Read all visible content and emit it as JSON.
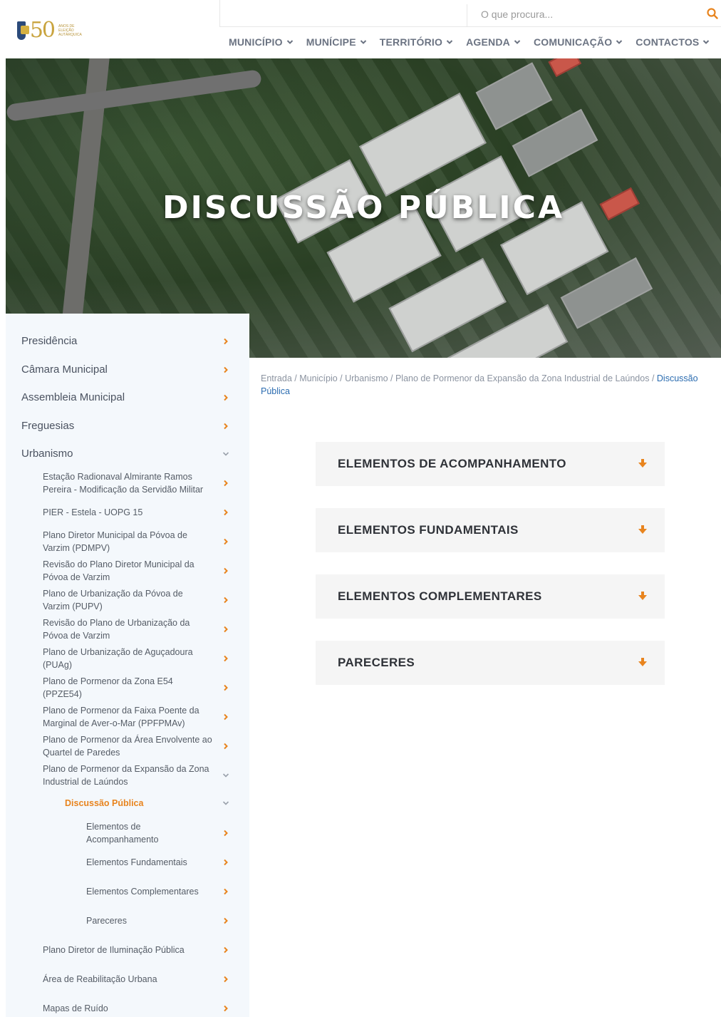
{
  "header": {
    "logo": {
      "number": "50",
      "tagline": "ANOS DE ELEIÇÃO AUTÁRQUICA"
    },
    "search": {
      "placeholder": "O que procura..."
    },
    "nav": [
      {
        "label": "MUNICÍPIO"
      },
      {
        "label": "MUNÍCIPE"
      },
      {
        "label": "TERRITÓRIO"
      },
      {
        "label": "AGENDA"
      },
      {
        "label": "COMUNICAÇÃO"
      },
      {
        "label": "CONTACTOS"
      }
    ]
  },
  "hero": {
    "title": "DISCUSSÃO PÚBLICA"
  },
  "sidebar": {
    "top": [
      {
        "label": "Presidência"
      },
      {
        "label": "Câmara Municipal"
      },
      {
        "label": "Assembleia Municipal"
      },
      {
        "label": "Freguesias"
      },
      {
        "label": "Urbanismo"
      }
    ],
    "urbanismo": [
      {
        "label": "Estação Radionaval Almirante Ramos Pereira - Modificação da Servidão Militar"
      },
      {
        "label": "PIER - Estela - UOPG 15"
      },
      {
        "label": "Plano Diretor Municipal da Póvoa de Varzim (PDMPV)"
      },
      {
        "label": "Revisão do Plano Diretor Municipal da Póvoa de Varzim"
      },
      {
        "label": "Plano de Urbanização da Póvoa de Varzim (PUPV)"
      },
      {
        "label": "Revisão do Plano de Urbanização da Póvoa de Varzim"
      },
      {
        "label": "Plano de Urbanização de Aguçadoura (PUAg)"
      },
      {
        "label": "Plano de Pormenor da Zona E54 (PPZE54)"
      },
      {
        "label": "Plano de Pormenor da Faixa Poente da Marginal de Aver-o-Mar (PPFPMAv)"
      },
      {
        "label": "Plano de Pormenor da Área Envolvente ao Quartel de Paredes"
      },
      {
        "label": "Plano de Pormenor da Expansão da Zona Industrial de Laúndos"
      }
    ],
    "active": {
      "label": "Discussão Pública"
    },
    "sub": [
      {
        "label": "Elementos de Acompanhamento"
      },
      {
        "label": "Elementos Fundamentais"
      },
      {
        "label": "Elementos Complementares"
      },
      {
        "label": "Pareceres"
      }
    ],
    "after": [
      {
        "label": "Plano Diretor de Iluminação Pública"
      },
      {
        "label": "Área de Reabilitação Urbana"
      },
      {
        "label": "Mapas de Ruído"
      }
    ]
  },
  "breadcrumb": {
    "trail": "Entrada / Município / Urbanismo / Plano de Pormenor da Expansão da Zona Industrial de Laúndos / ",
    "current": "Discussão Pública"
  },
  "accordions": [
    {
      "label": "ELEMENTOS DE ACOMPANHAMENTO"
    },
    {
      "label": "ELEMENTOS FUNDAMENTAIS"
    },
    {
      "label": "ELEMENTOS COMPLEMENTARES"
    },
    {
      "label": "PARECERES"
    }
  ],
  "colors": {
    "accent": "#e8841e",
    "link": "#2b6cb0",
    "sidebar_bg": "#f4f8fc"
  }
}
